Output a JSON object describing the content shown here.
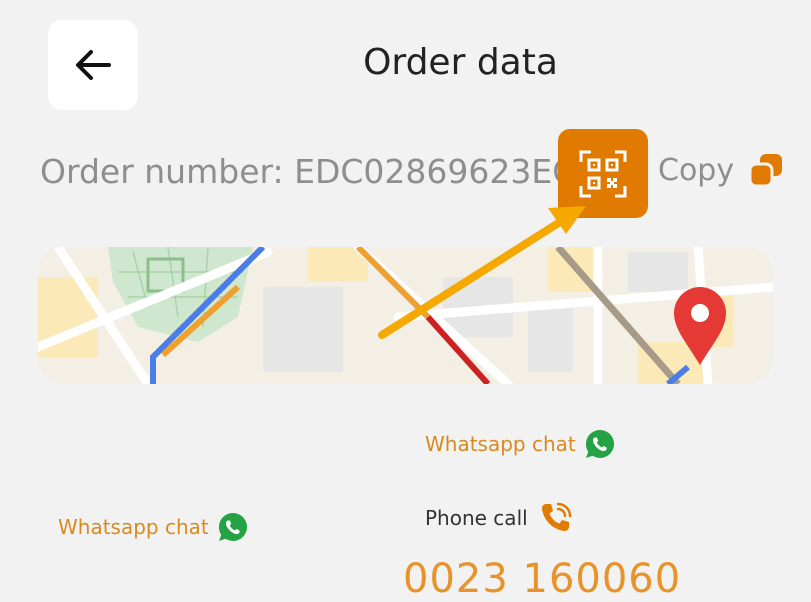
{
  "header": {
    "title": "Order data",
    "back_icon": "arrow-left-icon"
  },
  "order": {
    "label": "Order number: EDC02869623EG",
    "qr_icon": "qr-code-icon",
    "copy_label": "Copy",
    "copy_icon": "copy-icon"
  },
  "map": {
    "pin_icon": "map-pin-icon"
  },
  "contacts": {
    "whatsapp_top": "Whatsapp chat",
    "whatsapp_left": "Whatsapp chat",
    "phone_label": "Phone call",
    "phone_number": "0023 160060",
    "whatsapp_icon": "whatsapp-icon",
    "phone_icon": "phone-ringing-icon"
  },
  "colors": {
    "accent": "#e07a00",
    "link": "#d98a1f",
    "whatsapp": "#25a244",
    "pin": "#e53935",
    "annotation_arrow": "#f5a800"
  }
}
